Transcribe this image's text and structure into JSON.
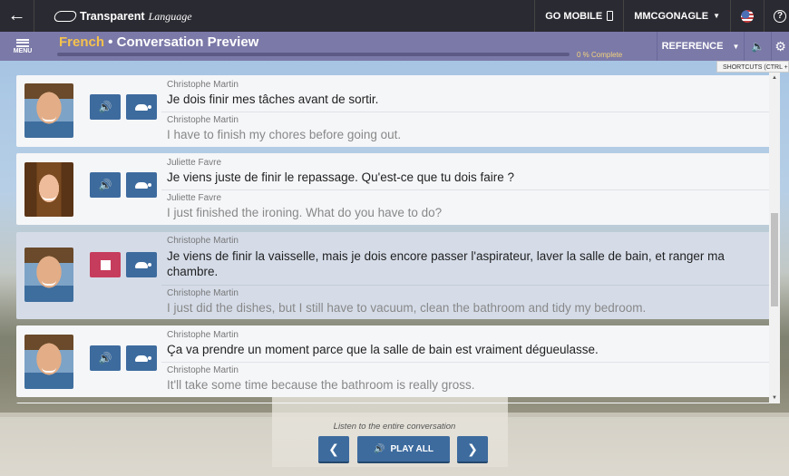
{
  "topbar": {
    "back_icon": "arrow-left-icon",
    "logo_bold": "Transparent",
    "logo_italic": "Language",
    "go_mobile": "GO MOBILE",
    "user": "MMCGONAGLE",
    "flag_icon": "us-flag-icon",
    "help_icon": "help-icon"
  },
  "lesson": {
    "menu_label": "MENU",
    "language": "French",
    "separator": " • ",
    "title": "Conversation Preview",
    "progress_text": "0 % Complete",
    "progress_value": 0,
    "reference_label": "REFERENCE",
    "shortcuts_tooltip": "SHORTCUTS (CTRL + /)"
  },
  "conversation": [
    {
      "speaker_fr": "Christophe Martin",
      "french": "Je dois finir mes tâches avant de sortir.",
      "speaker_en": "Christophe Martin",
      "english": "I have to finish my chores before going out.",
      "active": false
    },
    {
      "speaker_fr": "Juliette Favre",
      "french": "Je viens juste de finir le repassage. Qu'est-ce que tu dois faire ?",
      "speaker_en": "Juliette Favre",
      "english": "I just finished the ironing. What do you have to do?",
      "active": false
    },
    {
      "speaker_fr": "Christophe Martin",
      "french": "Je viens de finir la vaisselle, mais je dois encore passer l'aspirateur, laver la salle de bain, et ranger ma chambre.",
      "speaker_en": "Christophe Martin",
      "english": "I just did the dishes, but I still have to vacuum, clean the bathroom and tidy my bedroom.",
      "active": true
    },
    {
      "speaker_fr": "Christophe Martin",
      "french": "Ça va prendre un moment parce que la salle de bain est vraiment dégueulasse.",
      "speaker_en": "Christophe Martin",
      "english": "It'll take some time because the bathroom is really gross.",
      "active": false
    }
  ],
  "footer": {
    "caption": "Listen to the entire conversation",
    "play_all": "PLAY ALL"
  },
  "colors": {
    "accent": "#3d6b9e",
    "stop": "#c63c5c",
    "lesson_bar": "#7b79a8",
    "language_highlight": "#f5c24c"
  }
}
